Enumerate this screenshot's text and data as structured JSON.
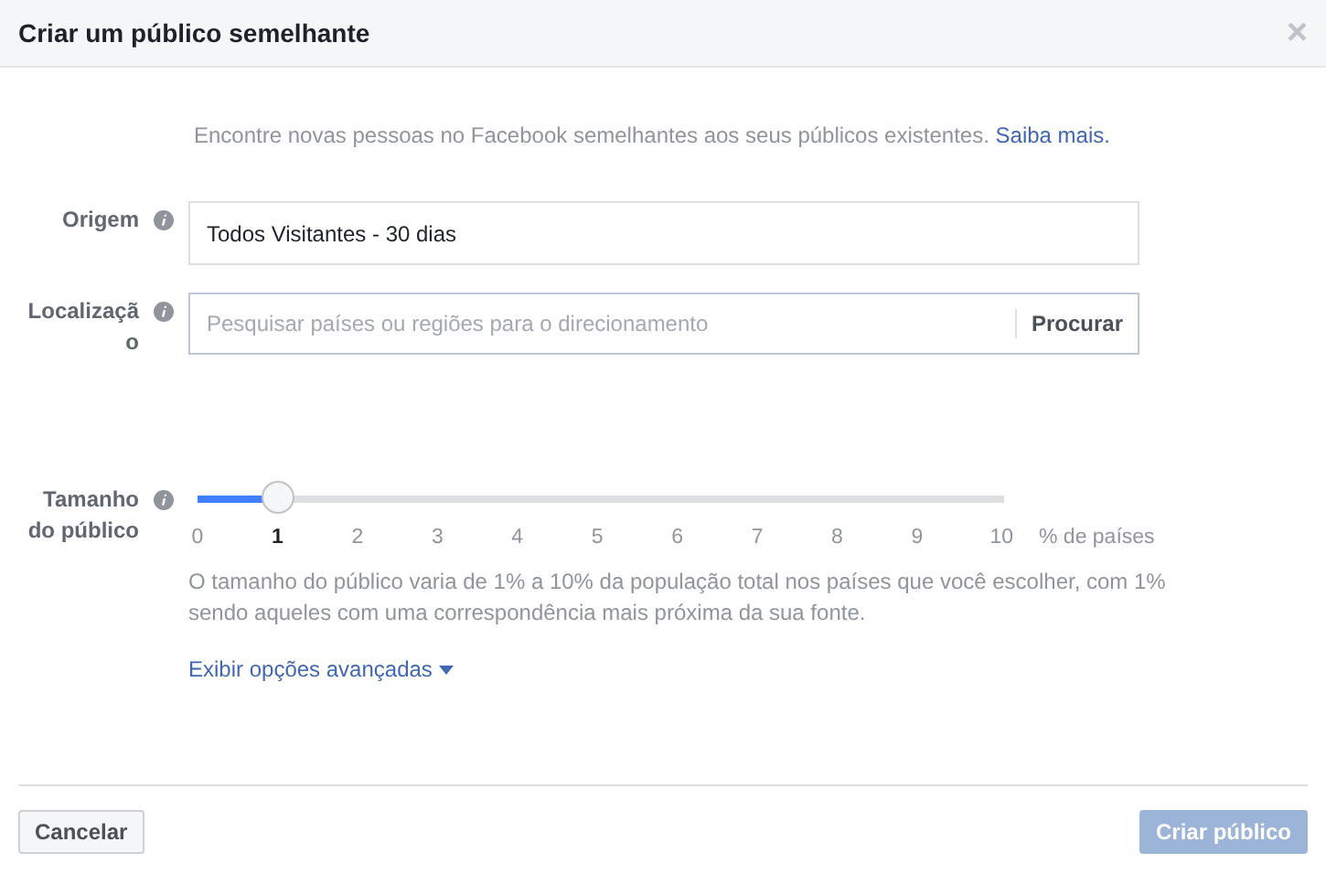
{
  "dialog": {
    "title": "Criar um público semelhante",
    "close": "×"
  },
  "intro": {
    "text": "Encontre novas pessoas no Facebook semelhantes aos seus públicos existentes. ",
    "link": "Saiba mais."
  },
  "fields": [
    {
      "kind": "text",
      "label": "Origem",
      "value": "Todos Visitantes - 30 dias"
    },
    {
      "kind": "search",
      "label": "Localização",
      "placeholder": "Pesquisar países ou regiões para o direcionamento",
      "button": "Procurar"
    }
  ],
  "audience_size": {
    "label": "Tamanho do público",
    "level": 0.1,
    "ticks": [
      {
        "label": "0",
        "selected": false
      },
      {
        "label": "1",
        "selected": true
      },
      {
        "label": "2",
        "selected": false
      },
      {
        "label": "3",
        "selected": false
      },
      {
        "label": "4",
        "selected": false
      },
      {
        "label": "5",
        "selected": false
      },
      {
        "label": "6",
        "selected": false
      },
      {
        "label": "7",
        "selected": false
      },
      {
        "label": "8",
        "selected": false
      },
      {
        "label": "9",
        "selected": false
      },
      {
        "label": "10",
        "selected": false
      }
    ],
    "unit": "% de países",
    "help": "O tamanho do público varia de 1% a 10% da população total nos países que você escolher, com 1% sendo aqueles com uma correspondência mais próxima da sua fonte.",
    "advanced_link": "Exibir opções avançadas"
  },
  "buttons": [
    {
      "kind": "secondary",
      "label": "Cancelar",
      "disabled": false
    },
    {
      "kind": "primary",
      "label": "Criar público",
      "disabled": true
    }
  ]
}
